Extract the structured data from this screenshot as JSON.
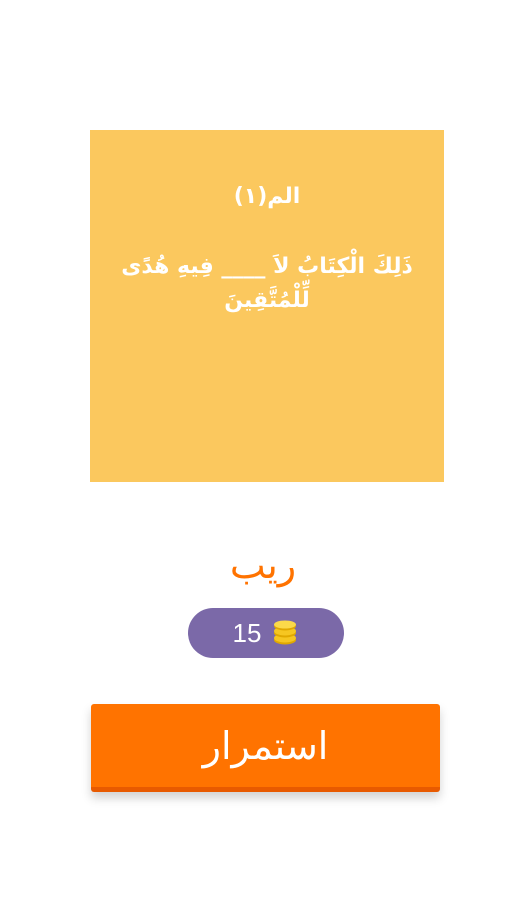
{
  "question": {
    "verse_number_line": "الم(١)",
    "verse_text": "ذَلِكَ الْكِتَابُ لاَ ____ فِيهِ هُدًى لِّلْمُتَّقِينَ"
  },
  "answer": {
    "word": "ريب"
  },
  "coins": {
    "value": "15",
    "icon": "coins-icon"
  },
  "continue_button": {
    "label": "استمرار"
  },
  "colors": {
    "card_background": "#fbc85e",
    "accent_orange": "#ff7300",
    "coins_pill": "#7b69a8",
    "coin_gold": "#f6c621"
  }
}
